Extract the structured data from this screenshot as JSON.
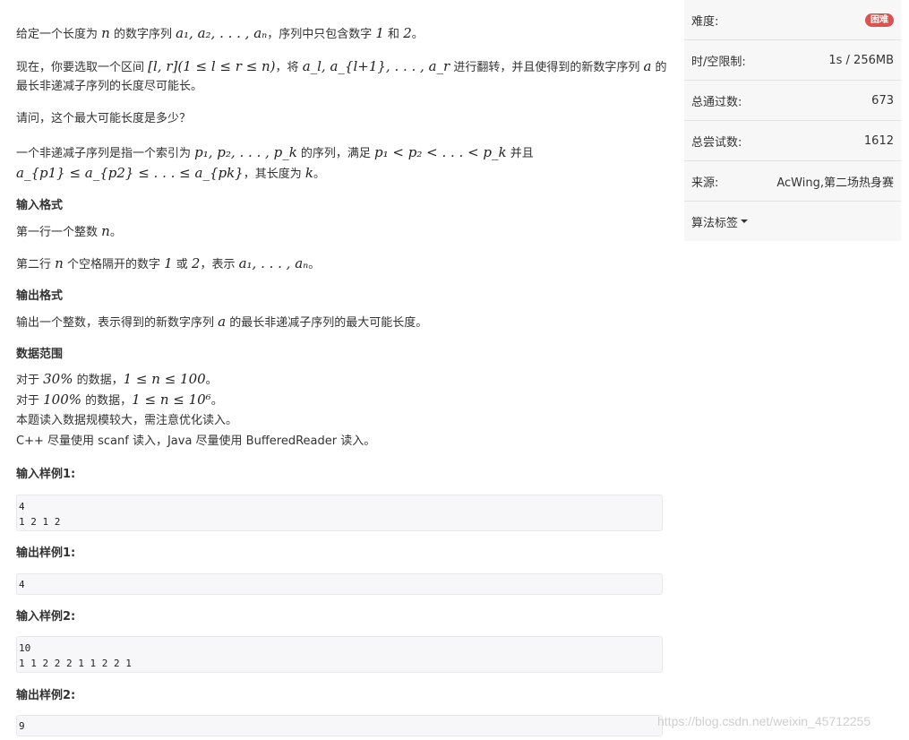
{
  "problem": {
    "p1": {
      "a": "给定一个长度为 ",
      "m1": "n",
      "b": " 的数字序列 ",
      "m2": "a₁, a₂, . . . , aₙ",
      "c": "，序列中只包含数字 ",
      "m3": "1",
      "d": " 和 ",
      "m4": "2",
      "e": "。"
    },
    "p2": {
      "a": "现在，你要选取一个区间 ",
      "m1": "[l, r](1 ≤ l ≤ r ≤ n)",
      "b": "，将 ",
      "m2": "a_l, a_{l+1}, . . . , a_r",
      "c": " 进行翻转，并且使得到的新数字序列 ",
      "m3": "a",
      "d": " 的"
    },
    "p2b": "最长非递减子序列的长度尽可能长。",
    "p3": "请问，这个最大可能长度是多少？",
    "p4": {
      "a": "一个非递减子序列是指一个索引为 ",
      "m1": "p₁, p₂, . . . , p_k",
      "b": " 的序列，满足 ",
      "m2": "p₁ < p₂ < . . . < p_k",
      "c": " 并且"
    },
    "p4b": {
      "m1": "a_{p1} ≤ a_{p2} ≤ . . . ≤ a_{pk}",
      "a": "，其长度为 ",
      "m2": "k",
      "b": "。"
    },
    "input_title": "输入格式",
    "input_l1": {
      "a": "第一行一个整数 ",
      "m1": "n",
      "b": "。"
    },
    "input_l2": {
      "a": "第二行 ",
      "m1": "n",
      "b": " 个空格隔开的数字 ",
      "m2": "1",
      "c": " 或 ",
      "m3": "2",
      "d": "，表示 ",
      "m4": "a₁, . . . , aₙ",
      "e": "。"
    },
    "output_title": "输出格式",
    "output_l1": {
      "a": "输出一个整数，表示得到的新数字序列 ",
      "m1": "a",
      "b": " 的最长非递减子序列的最大可能长度。"
    },
    "range_title": "数据范围",
    "range_l1": {
      "a": "对于 ",
      "m1": "30%",
      "b": " 的数据，",
      "m2": "1 ≤ n ≤ 100",
      "c": "。"
    },
    "range_l2": {
      "a": "对于 ",
      "m1": "100%",
      "b": " 的数据，",
      "m2": "1 ≤ n ≤ 10⁶",
      "c": "。"
    },
    "range_l3": "本题读入数据规模较大，需注意优化读入。",
    "range_l4": "C++ 尽量使用 scanf 读入，Java 尽量使用 BufferedReader 读入。",
    "sample_in1_title": "输入样例1:",
    "sample_in1": "4\n1 2 1 2",
    "sample_out1_title": "输出样例1:",
    "sample_out1": "4",
    "sample_in2_title": "输入样例2:",
    "sample_in2": "10\n1 1 2 2 2 1 1 2 2 1",
    "sample_out2_title": "输出样例2:",
    "sample_out2": "9"
  },
  "sidebar": {
    "difficulty_label": "难度:",
    "difficulty_value": "困难",
    "limit_label": "时/空限制:",
    "limit_value": "1s / 256MB",
    "passed_label": "总通过数:",
    "passed_value": "673",
    "tried_label": "总尝试数:",
    "tried_value": "1612",
    "source_label": "来源:",
    "source_value": "AcWing,第二场热身赛",
    "tags_label": "算法标签"
  },
  "watermark": "https://blog.csdn.net/weixin_45712255",
  "colors": {
    "badge": "#d9534f",
    "sidebar_bg": "#f7f7f7",
    "code_bg": "#f7f7f9"
  }
}
